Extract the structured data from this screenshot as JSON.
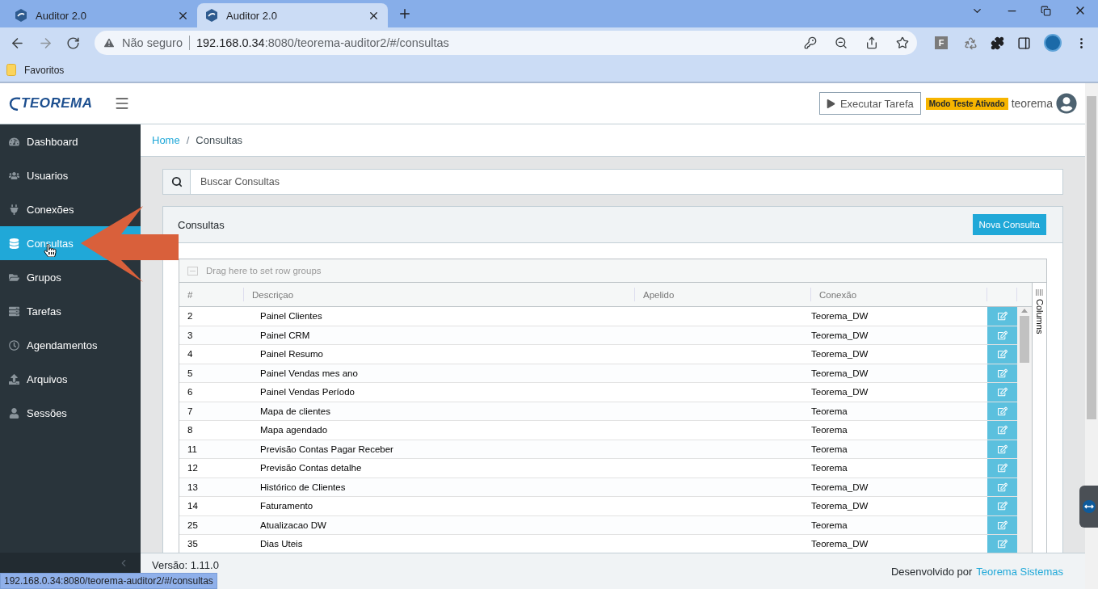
{
  "browser": {
    "tabs": [
      {
        "title": "Auditor 2.0",
        "selected": false
      },
      {
        "title": "Auditor 2.0",
        "selected": true
      }
    ],
    "security": "Não seguro",
    "url_host": "192.168.0.34",
    "url_path": ":8080/teorema-auditor2/#/consultas",
    "extension_badge": "F",
    "bookmarks": [
      "Favoritos"
    ],
    "status_url": "192.168.0.34:8080/teorema-auditor2/#/consultas"
  },
  "header": {
    "logo": "TEOREMA",
    "run_button": "Executar Tarefa",
    "mode_badge": "Modo Teste Ativado",
    "user": "teorema"
  },
  "sidebar": {
    "items": [
      {
        "label": "Dashboard",
        "selected": false
      },
      {
        "label": "Usuarios",
        "selected": false
      },
      {
        "label": "Conexões",
        "selected": false
      },
      {
        "label": "Consultas",
        "selected": true
      },
      {
        "label": "Grupos",
        "selected": false
      },
      {
        "label": "Tarefas",
        "selected": false
      },
      {
        "label": "Agendamentos",
        "selected": false
      },
      {
        "label": "Arquivos",
        "selected": false
      },
      {
        "label": "Sessões",
        "selected": false
      }
    ]
  },
  "breadcrumb": {
    "items": [
      {
        "label": "Home",
        "link": true
      },
      {
        "label": "Consultas",
        "link": false
      }
    ],
    "separator": "/"
  },
  "search": {
    "placeholder": "Buscar Consultas"
  },
  "panel": {
    "title": "Consultas",
    "new_button": "Nova Consulta"
  },
  "grid": {
    "group_hint": "Drag here to set row groups",
    "columns": [
      "#",
      "Descriçao",
      "Apelido",
      "Conexão"
    ],
    "side_tab": "Columns",
    "rows": [
      {
        "id": "2",
        "descricao": "Painel Clientes",
        "conexao": "Teorema_DW"
      },
      {
        "id": "3",
        "descricao": "Painel CRM",
        "conexao": "Teorema_DW"
      },
      {
        "id": "4",
        "descricao": "Painel Resumo",
        "conexao": "Teorema_DW"
      },
      {
        "id": "5",
        "descricao": "Painel Vendas mes ano",
        "conexao": "Teorema_DW"
      },
      {
        "id": "6",
        "descricao": "Painel Vendas Período",
        "conexao": "Teorema_DW"
      },
      {
        "id": "7",
        "descricao": "Mapa de clientes",
        "conexao": "Teorema"
      },
      {
        "id": "8",
        "descricao": "Mapa agendado",
        "conexao": "Teorema"
      },
      {
        "id": "11",
        "descricao": "Previsão Contas Pagar Receber",
        "conexao": "Teorema"
      },
      {
        "id": "12",
        "descricao": "Previsão Contas detalhe",
        "conexao": "Teorema"
      },
      {
        "id": "13",
        "descricao": "Histórico de Clientes",
        "conexao": "Teorema_DW"
      },
      {
        "id": "14",
        "descricao": "Faturamento",
        "conexao": "Teorema_DW"
      },
      {
        "id": "25",
        "descricao": "Atualizacao DW",
        "conexao": "Teorema"
      },
      {
        "id": "35",
        "descricao": "Dias Uteis",
        "conexao": "Teorema_DW"
      }
    ]
  },
  "footer": {
    "version": "Versão: 1.11.0",
    "credit": "Desenvolvido por",
    "credit_link": "Teorema Sistemas"
  }
}
